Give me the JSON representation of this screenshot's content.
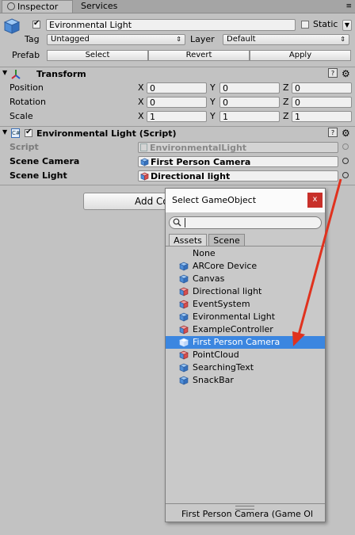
{
  "tabs": [
    {
      "label": "Inspector"
    },
    {
      "label": "Services"
    }
  ],
  "object": {
    "name": "Evironmental Light",
    "static_label": "Static",
    "tag_label": "Tag",
    "tag_value": "Untagged",
    "layer_label": "Layer",
    "layer_value": "Default",
    "prefab_label": "Prefab",
    "select_label": "Select",
    "revert_label": "Revert",
    "apply_label": "Apply"
  },
  "transform": {
    "title": "Transform",
    "rows": [
      {
        "label": "Position",
        "x": "0",
        "y": "0",
        "z": "0"
      },
      {
        "label": "Rotation",
        "x": "0",
        "y": "0",
        "z": "0"
      },
      {
        "label": "Scale",
        "x": "1",
        "y": "1",
        "z": "1"
      }
    ],
    "axis_x": "X",
    "axis_y": "Y",
    "axis_z": "Z"
  },
  "script_component": {
    "title": "Environmental Light (Script)",
    "script_label": "Script",
    "script_value": "EnvironmentalLight",
    "camera_label": "Scene Camera",
    "camera_value": "First Person Camera",
    "light_label": "Scene Light",
    "light_value": "Directional light"
  },
  "add_component_label": "Add Co",
  "popup": {
    "title": "Select GameObject",
    "close_label": "x",
    "search_value": "",
    "tabs": [
      {
        "label": "Assets"
      },
      {
        "label": "Scene"
      }
    ],
    "items": [
      {
        "label": "None"
      },
      {
        "label": "ARCore Device"
      },
      {
        "label": "Canvas"
      },
      {
        "label": "Directional light"
      },
      {
        "label": "EventSystem"
      },
      {
        "label": "Evironmental Light"
      },
      {
        "label": "ExampleController"
      },
      {
        "label": "First Person Camera"
      },
      {
        "label": "PointCloud"
      },
      {
        "label": "SearchingText"
      },
      {
        "label": "SnackBar"
      }
    ],
    "selected_index": 7,
    "footer": "First Person Camera (Game Ol"
  },
  "colors": {
    "selection": "#3b86e0",
    "arrow": "#e0321e",
    "close_button": "#c8302a"
  }
}
